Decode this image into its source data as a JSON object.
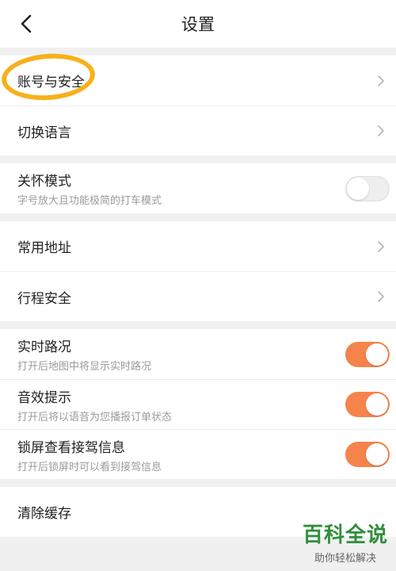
{
  "header": {
    "title": "设置"
  },
  "account": {
    "label": "账号与安全"
  },
  "language": {
    "label": "切换语言"
  },
  "care_mode": {
    "label": "关怀模式",
    "sub": "字号放大且功能极简的打车模式",
    "enabled": false
  },
  "address": {
    "label": "常用地址"
  },
  "trip_safety": {
    "label": "行程安全"
  },
  "traffic": {
    "label": "实时路况",
    "sub": "打开后地图中将显示实时路况",
    "enabled": true
  },
  "sound": {
    "label": "音效提示",
    "sub": "打开后将以语音为您播报订单状态",
    "enabled": true
  },
  "lockscreen": {
    "label": "锁屏查看接驾信息",
    "sub": "打开后锁屏时可以看到接驾信息",
    "enabled": true
  },
  "cache": {
    "label": "清除缓存"
  },
  "watermark": {
    "brand": "百科全说",
    "slogan": "助你轻松解决"
  },
  "colors": {
    "accent": "#f4844b",
    "highlight": "#f6b11a",
    "watermark": "#2f8f3a"
  },
  "icons": {
    "back": "back-arrow-icon",
    "chevron": "chevron-right-icon"
  }
}
